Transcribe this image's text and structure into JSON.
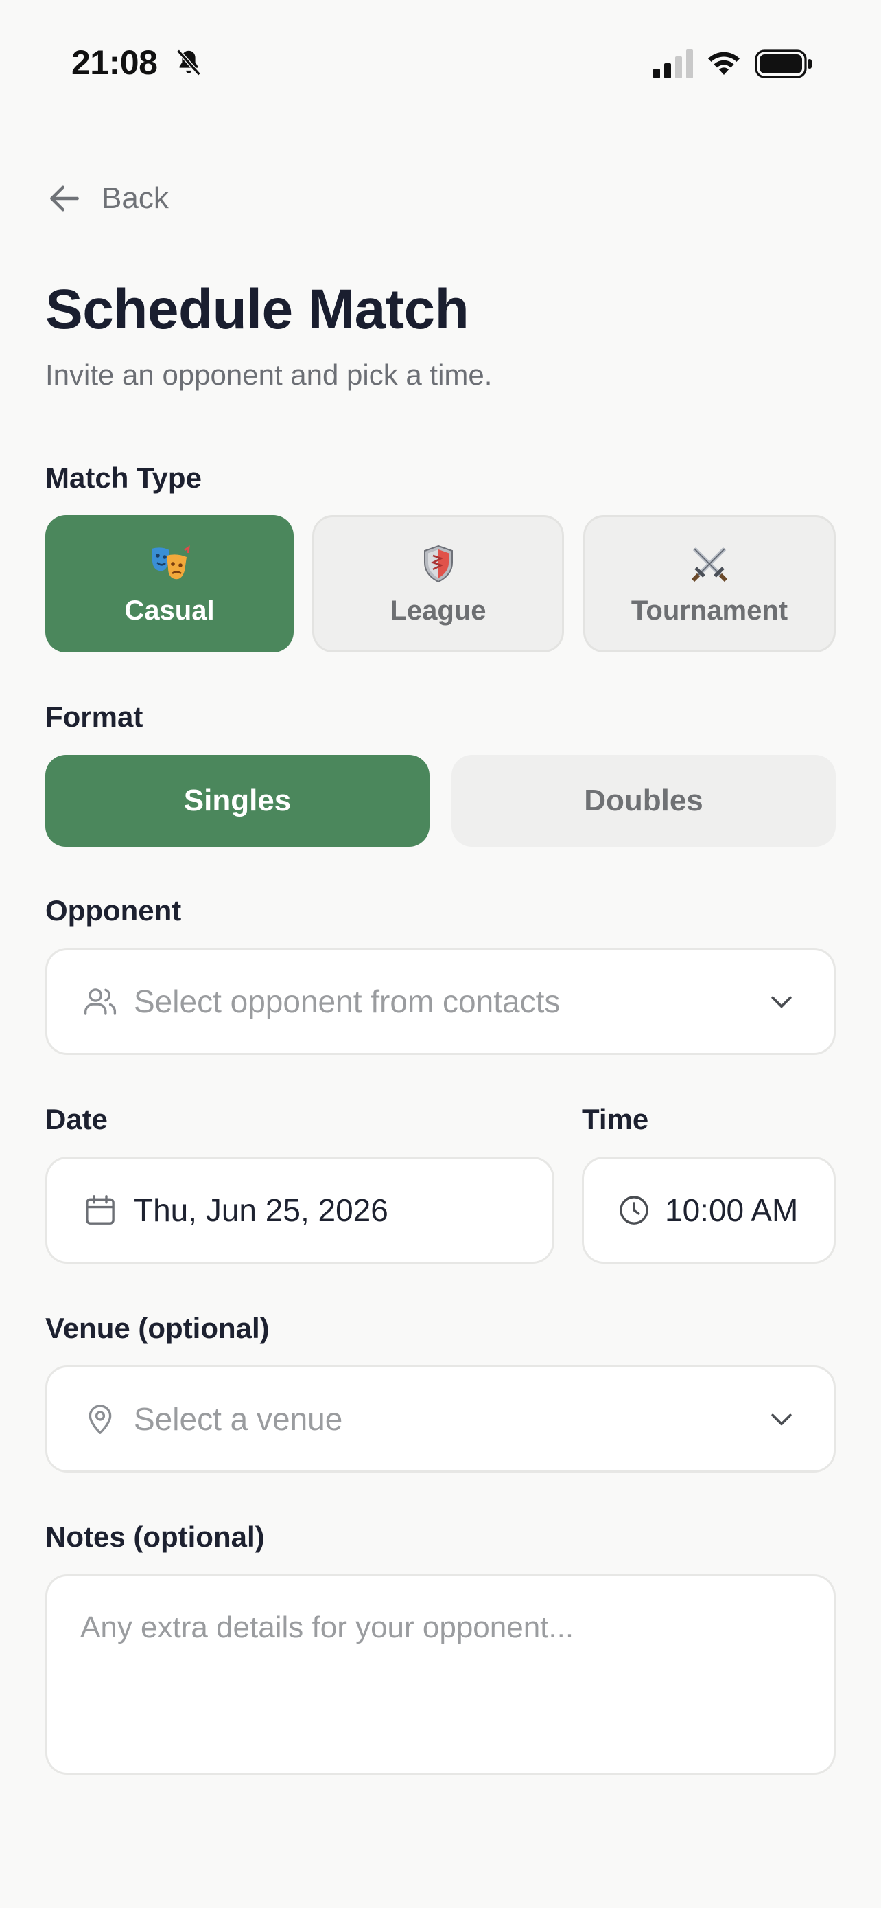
{
  "status_bar": {
    "time": "21:08",
    "bell_icon": "bell-slash-icon",
    "signal_icon": "cellular-signal-icon",
    "wifi_icon": "wifi-icon",
    "battery_icon": "battery-full-icon"
  },
  "nav": {
    "back_label": "Back",
    "back_icon": "arrow-left-icon"
  },
  "header": {
    "title": "Schedule Match",
    "subtitle": "Invite an opponent and pick a time."
  },
  "match_type": {
    "label": "Match Type",
    "options": [
      {
        "label": "Casual",
        "icon": "theater-masks-icon",
        "selected": true
      },
      {
        "label": "League",
        "icon": "shield-icon",
        "selected": false
      },
      {
        "label": "Tournament",
        "icon": "crossed-swords-icon",
        "selected": false
      }
    ]
  },
  "format": {
    "label": "Format",
    "options": [
      {
        "label": "Singles",
        "selected": true
      },
      {
        "label": "Doubles",
        "selected": false
      }
    ]
  },
  "opponent": {
    "label": "Opponent",
    "placeholder": "Select opponent from contacts",
    "icon": "users-icon"
  },
  "date": {
    "label": "Date",
    "value": "Thu, Jun 25, 2026",
    "icon": "calendar-icon"
  },
  "time": {
    "label": "Time",
    "value": "10:00 AM",
    "icon": "clock-icon"
  },
  "venue": {
    "label": "Venue (optional)",
    "placeholder": "Select a venue",
    "icon": "map-pin-icon"
  },
  "notes": {
    "label": "Notes (optional)",
    "placeholder": "Any extra details for your opponent..."
  },
  "colors": {
    "accent": "#4b875c",
    "background": "#f9f9f8",
    "unselected_bg": "#efefee",
    "text_primary": "#1a1e2f",
    "text_muted": "#6c6f75",
    "placeholder": "#9a9c9f"
  }
}
